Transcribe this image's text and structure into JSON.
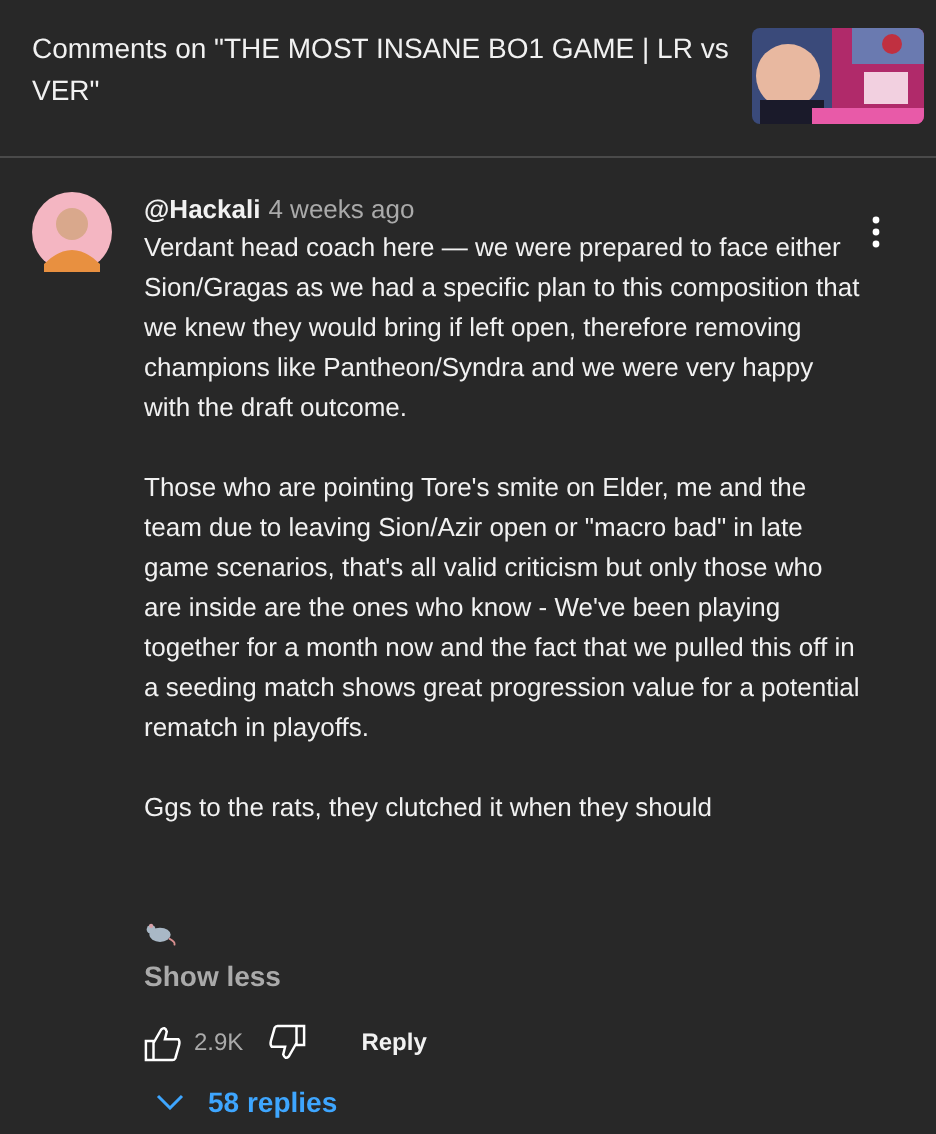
{
  "header": {
    "title": "Comments on \"THE MOST INSANE BO1 GAME | LR vs VER\""
  },
  "comment": {
    "author": "@Hackali",
    "time": "4 weeks ago",
    "paragraphs": [
      "Verdant head coach here — we were prepared to face either Sion/Gragas as we had a specific plan to this composition that we knew they would bring if left open, therefore removing champions like Pantheon/Syndra and we were very happy with the draft outcome.",
      "Those who are pointing Tore's smite on Elder, me and the team due to leaving Sion/Azir open or \"macro bad\" in late game scenarios, that's all valid criticism but only those who are inside are the ones who know - We've been playing together for a month now and the fact that we pulled this off in a seeding match shows great progression value for a potential rematch in playoffs.",
      "Ggs to the rats, they clutched it when they should"
    ],
    "toggle": "Show less",
    "likes": "2.9K",
    "reply": "Reply",
    "replies": "58 replies"
  }
}
